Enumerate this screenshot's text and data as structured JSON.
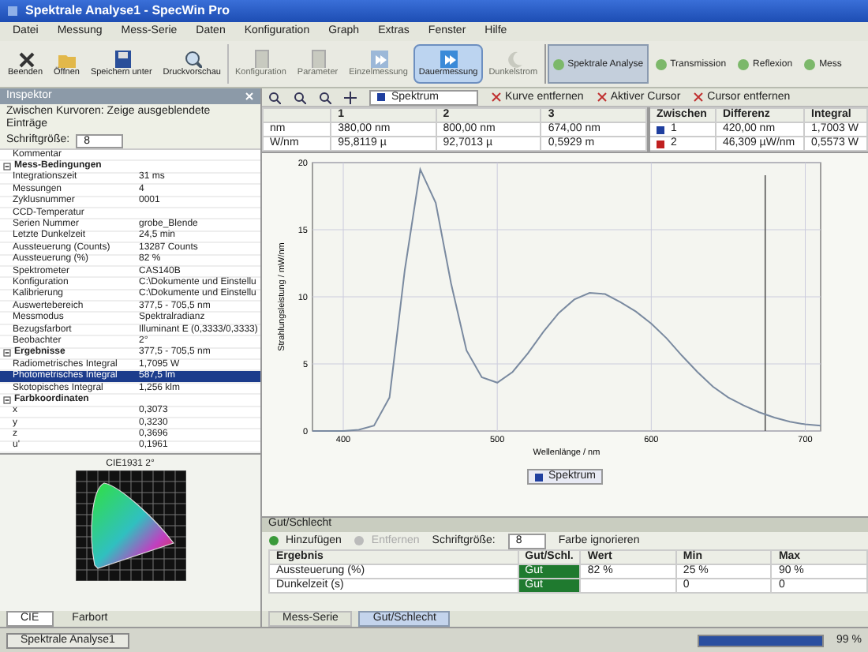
{
  "window": {
    "title": "Spektrale Analyse1 - SpecWin Pro"
  },
  "menu": [
    "Datei",
    "Messung",
    "Mess-Serie",
    "Daten",
    "Konfiguration",
    "Graph",
    "Extras",
    "Fenster",
    "Hilfe"
  ],
  "toolbar": [
    {
      "label": "Beenden",
      "kind": "close",
      "disabled": false,
      "selected": false
    },
    {
      "label": "Öffnen",
      "kind": "folder",
      "disabled": false,
      "selected": false
    },
    {
      "label": "Speichern unter",
      "kind": "disk",
      "disabled": false,
      "selected": false
    },
    {
      "label": "Druckvorschau",
      "kind": "magnifier",
      "disabled": false,
      "selected": false
    },
    {
      "label": "Konfiguration",
      "kind": "doc",
      "disabled": true,
      "selected": false
    },
    {
      "label": "Parameter",
      "kind": "doc",
      "disabled": true,
      "selected": false
    },
    {
      "label": "Einzelmessung",
      "kind": "play",
      "disabled": true,
      "selected": false
    },
    {
      "label": "Dauermessung",
      "kind": "play",
      "disabled": false,
      "selected": true
    },
    {
      "label": "Dunkelstrom",
      "kind": "moon",
      "disabled": true,
      "selected": false
    }
  ],
  "modes": [
    {
      "label": "Spektrale Analyse",
      "selected": true
    },
    {
      "label": "Transmission",
      "selected": false
    },
    {
      "label": "Reflexion",
      "selected": false
    },
    {
      "label": "Mess",
      "selected": false
    }
  ],
  "inspector": {
    "title": "Inspektor",
    "filter": "Zwischen Kurvoren: Zeige ausgeblendete Einträge",
    "font_size_label": "Schriftgröße:",
    "font_size": "8",
    "rows": [
      {
        "kind": "prop",
        "name": "Kommentar",
        "value": "",
        "selected": false
      },
      {
        "kind": "group",
        "name": "Mess-Bedingungen",
        "value": "",
        "selected": false
      },
      {
        "kind": "prop",
        "name": "Integrationszeit",
        "value": "31 ms",
        "selected": false
      },
      {
        "kind": "prop",
        "name": "Messungen",
        "value": "4",
        "selected": false
      },
      {
        "kind": "prop",
        "name": "Zyklusnummer",
        "value": "0001",
        "selected": false
      },
      {
        "kind": "prop",
        "name": "CCD-Temperatur",
        "value": "",
        "selected": false
      },
      {
        "kind": "prop",
        "name": "Serien Nummer",
        "value": "grobe_Blende",
        "selected": false
      },
      {
        "kind": "prop",
        "name": "Letzte Dunkelzeit",
        "value": "24,5 min",
        "selected": false
      },
      {
        "kind": "prop",
        "name": "Aussteuerung (Counts)",
        "value": "13287 Counts",
        "selected": false
      },
      {
        "kind": "prop",
        "name": "Aussteuerung (%)",
        "value": "82 %",
        "selected": false
      },
      {
        "kind": "prop",
        "name": "Spektrometer",
        "value": "CAS140B",
        "selected": false
      },
      {
        "kind": "prop",
        "name": "Konfiguration",
        "value": "C:\\Dokumente und Einstellu",
        "selected": false
      },
      {
        "kind": "prop",
        "name": "Kalibrierung",
        "value": "C:\\Dokumente und Einstellu",
        "selected": false
      },
      {
        "kind": "prop",
        "name": "Auswertebereich",
        "value": "377,5 - 705,5 nm",
        "selected": false
      },
      {
        "kind": "prop",
        "name": "Messmodus",
        "value": "Spektralradianz",
        "selected": false
      },
      {
        "kind": "prop",
        "name": "Bezugsfarbort",
        "value": "Illuminant E (0,3333/0,3333)",
        "selected": false
      },
      {
        "kind": "prop",
        "name": "Beobachter",
        "value": "2°",
        "selected": false
      },
      {
        "kind": "group",
        "name": "Ergebnisse",
        "value": "377,5 - 705,5 nm",
        "selected": false
      },
      {
        "kind": "prop",
        "name": "Radiometrisches Integral",
        "value": "1,7095 W",
        "selected": false
      },
      {
        "kind": "prop",
        "name": "Photometrisches Integral",
        "value": "587,5 lm",
        "selected": true
      },
      {
        "kind": "prop",
        "name": "Skotopisches Integral",
        "value": "1,256 klm",
        "selected": false
      },
      {
        "kind": "group",
        "name": "Farbkoordinaten",
        "value": "",
        "selected": false
      },
      {
        "kind": "prop",
        "name": "x",
        "value": "0,3073",
        "selected": false
      },
      {
        "kind": "prop",
        "name": "y",
        "value": "0,3230",
        "selected": false
      },
      {
        "kind": "prop",
        "name": "z",
        "value": "0,3696",
        "selected": false
      },
      {
        "kind": "prop",
        "name": "u'",
        "value": "0,1961",
        "selected": false
      }
    ]
  },
  "cie": {
    "title": "CIE1931 2°"
  },
  "left_tabs": [
    {
      "label": "CIE",
      "selected": true
    },
    {
      "label": "Farbort",
      "selected": false
    }
  ],
  "chart_toolbar": {
    "curve": "Spektrum",
    "buttons": [
      "Kurve entfernen",
      "Aktiver Cursor",
      "Cursor entfernen"
    ]
  },
  "cursor_table": {
    "columns": [
      "",
      "1",
      "2",
      "3"
    ],
    "rows": [
      [
        "nm",
        "380,00 nm",
        "800,00 nm",
        "674,00 nm"
      ],
      [
        "W/nm",
        "95,8119 µ",
        "92,7013 µ",
        "0,5929 m"
      ]
    ]
  },
  "diff_table": {
    "columns": [
      "Zwischen",
      "Differenz",
      "Integral"
    ],
    "rows": [
      {
        "cursor": "1",
        "color": "#1f3f9f",
        "difference": "420,00 nm",
        "integral": "1,7003 W"
      },
      {
        "cursor": "2",
        "color": "#c02020",
        "difference": "46,309 µW/nm",
        "integral": "0,5573 W"
      }
    ]
  },
  "chart_data": {
    "type": "line",
    "xlabel": "Wellenlänge / nm",
    "ylabel": "Strahlungsleistung / mW/nm",
    "xlim": [
      380,
      710
    ],
    "ylim": [
      0,
      20
    ],
    "xticks": [
      400,
      500,
      600,
      700
    ],
    "yticks": [
      0,
      5,
      10,
      15,
      20
    ],
    "x": [
      380,
      390,
      400,
      410,
      420,
      430,
      440,
      450,
      460,
      470,
      480,
      490,
      500,
      510,
      520,
      530,
      540,
      550,
      560,
      570,
      580,
      590,
      600,
      610,
      620,
      630,
      640,
      650,
      660,
      670,
      680,
      690,
      700,
      710
    ],
    "series": [
      {
        "name": "Spektrum",
        "color": "#7a8aa0",
        "values": [
          0,
          0,
          0,
          0.1,
          0.4,
          2.5,
          12,
          19.5,
          17,
          11,
          6,
          4,
          3.6,
          4.4,
          5.8,
          7.4,
          8.8,
          9.8,
          10.3,
          10.2,
          9.6,
          8.9,
          8,
          6.9,
          5.6,
          4.4,
          3.3,
          2.5,
          1.9,
          1.4,
          1,
          0.7,
          0.5,
          0.4
        ]
      }
    ],
    "grid": true,
    "ref_lines": [
      {
        "axis": "x",
        "value": 674
      }
    ]
  },
  "gut_schlecht": {
    "title": "Gut/Schlecht",
    "tools": [
      {
        "label": "Hinzufügen",
        "disabled": false
      },
      {
        "label": "Entfernen",
        "disabled": true
      }
    ],
    "font_size_label": "Schriftgröße:",
    "font_size": "8",
    "ignore_label": "Farbe ignorieren",
    "columns": [
      "Ergebnis",
      "Gut/Schl.",
      "Wert",
      "Min",
      "Max"
    ],
    "rows": [
      {
        "name": "Aussteuerung (%)",
        "status": "Gut",
        "value": "82 %",
        "min": "25 %",
        "max": "90 %"
      },
      {
        "name": "Dunkelzeit (s)",
        "status": "Gut",
        "value": "",
        "min": "0",
        "max": "0"
      }
    ]
  },
  "bottom_tabs": [
    {
      "label": "Mess-Serie",
      "selected": false
    },
    {
      "label": "Gut/Schlecht",
      "selected": true
    }
  ],
  "taskbar": {
    "task": "Spektrale Analyse1",
    "progress": {
      "level": 1,
      "reading": "99 %"
    }
  }
}
